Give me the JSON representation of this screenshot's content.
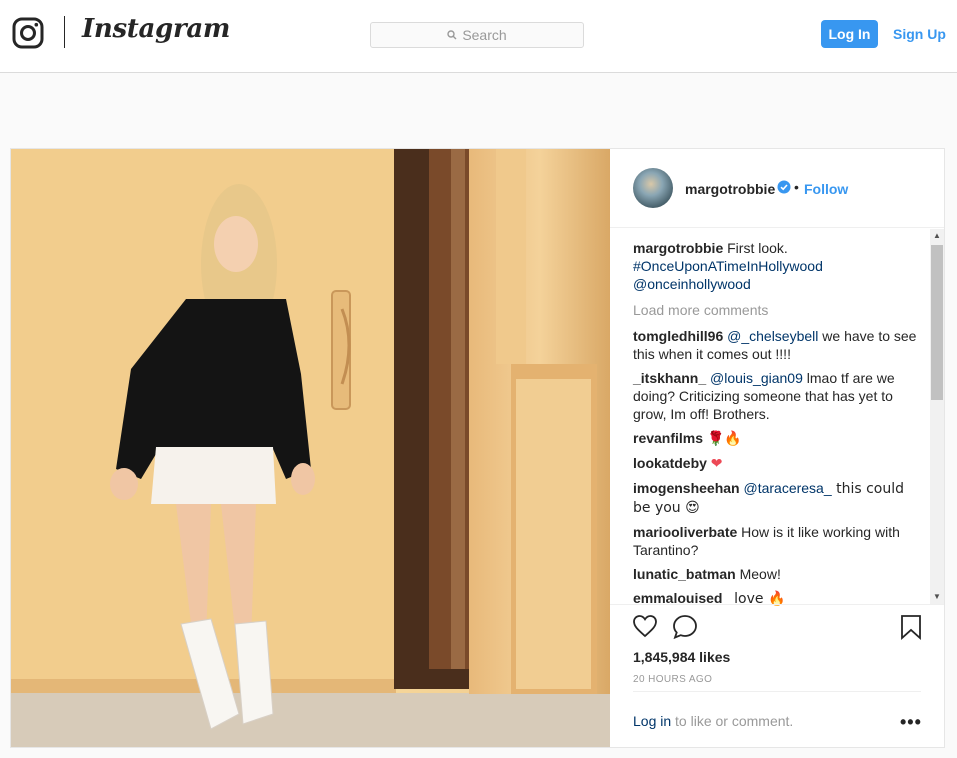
{
  "header": {
    "brand": "Instagram",
    "search_placeholder": "Search",
    "login_label": "Log In",
    "signup_label": "Sign Up"
  },
  "post": {
    "username": "margotrobbie",
    "follow_label": "Follow",
    "dot": "•",
    "caption": {
      "user": "margotrobbie",
      "text": " First look.",
      "hashtag": "#OnceUponATimeInHollywood",
      "mention": "@onceinhollywood"
    },
    "load_more": "Load more comments",
    "comments": [
      {
        "user": "tomgledhill96",
        "mention": "@_chelseybell",
        "text": " we have to see this when it comes out !!!!"
      },
      {
        "user": "_itskhann_",
        "mention": "@louis_gian09",
        "text": " lmao tf are we doing? Criticizing someone that has yet to grow, Im off! Brothers."
      },
      {
        "user": "revanfilms",
        "mention": "",
        "text": "🌹🔥"
      },
      {
        "user": "lookatdeby",
        "mention": "",
        "text": "❤"
      },
      {
        "user": "imogensheehan",
        "mention": "@taraceresa_",
        "text": " this could be you 😍"
      },
      {
        "user": "mariooliverbate",
        "mention": "",
        "text": "How is it like working with Tarantino?"
      },
      {
        "user": "lunatic_batman",
        "mention": "",
        "text": "Meow!"
      },
      {
        "user": "emmalouised_",
        "mention": "",
        "text": "love 🔥"
      }
    ],
    "likes": "1,845,984 likes",
    "time": "20 HOURS AGO",
    "login_link": "Log in",
    "login_suffix": " to like or comment.",
    "more": "•••"
  },
  "colors": {
    "accent": "#3897f0",
    "link": "#003569",
    "border": "#dbdbdb",
    "muted": "#999999"
  }
}
